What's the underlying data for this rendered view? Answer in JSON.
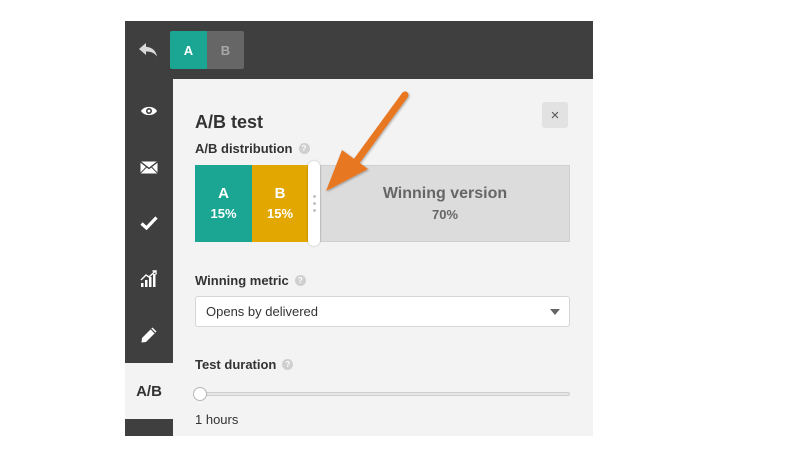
{
  "topbar": {
    "back_icon": "back-arrow-icon",
    "versions": [
      "A",
      "B"
    ],
    "active_version": "A"
  },
  "sidebar": {
    "items": [
      {
        "icon": "eye-icon"
      },
      {
        "icon": "envelope-icon"
      },
      {
        "icon": "checkmark-icon"
      },
      {
        "icon": "bar-chart-icon"
      },
      {
        "icon": "pencil-icon"
      },
      {
        "label": "A/B",
        "active": true
      }
    ]
  },
  "panel": {
    "title": "A/B test",
    "close_label": "×",
    "distribution": {
      "label": "A/B distribution",
      "help": "?",
      "segments": [
        {
          "name": "A",
          "percent": "15%",
          "value": 15,
          "color": "#1aa692"
        },
        {
          "name": "B",
          "percent": "15%",
          "value": 15,
          "color": "#e2a700"
        },
        {
          "name": "Winning version",
          "percent": "70%",
          "value": 70,
          "color": "#dcdcdc"
        }
      ]
    },
    "metric": {
      "label": "Winning metric",
      "help": "?",
      "selected": "Opens by delivered"
    },
    "duration": {
      "label": "Test duration",
      "help": "?",
      "value_text": "1 hours",
      "slider_fraction": 0
    }
  },
  "colors": {
    "accent_teal": "#1aa692",
    "accent_yellow": "#e2a700",
    "dark_bar": "#3f3f3f",
    "annotation_arrow": "#e87722"
  }
}
